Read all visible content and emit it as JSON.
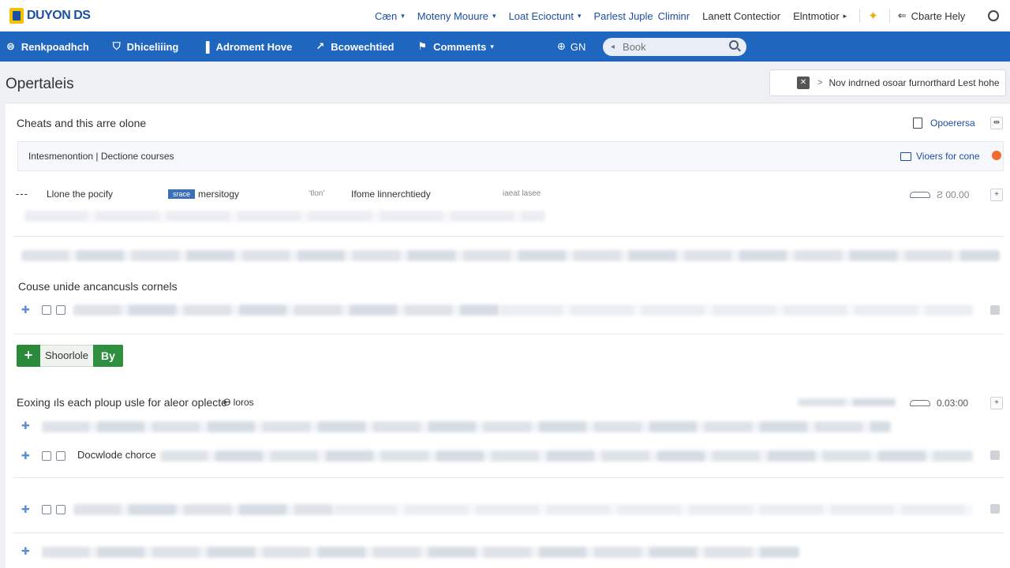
{
  "header": {
    "logo_text": "DUYON DS",
    "nav": [
      {
        "label": "Cæn",
        "caret": "▾"
      },
      {
        "label": "Moteny Mouure",
        "caret": "▾"
      },
      {
        "label": "Loat Ecioctunt",
        "caret": "▾"
      },
      {
        "label": "Parlest Juple"
      },
      {
        "label": "Climinr"
      }
    ],
    "nav_dark": [
      {
        "label": "Lanett Contectior"
      },
      {
        "label": "Elntmotior",
        "caret": "▸"
      }
    ],
    "fav_icon": "star-icon",
    "help_label": "Cbarte Hely",
    "help_back": "⇐"
  },
  "navbar": {
    "items": [
      {
        "icon": "⊜",
        "label": "Renkpoadhch"
      },
      {
        "icon": "⛉",
        "label": "Dhiceliiing"
      },
      {
        "icon": "▐",
        "label": "Adroment Hove"
      },
      {
        "icon": "↗",
        "label": "Bcowechtied"
      },
      {
        "icon": "⚑",
        "label": "Comments",
        "caret": "▾"
      }
    ],
    "lang_icon": "⊕",
    "lang_label": "GN",
    "search_placeholder": "Book",
    "search_caret": "◂"
  },
  "page": {
    "title": "Opertaleis",
    "notice_close": "✕",
    "notice_chev": ">",
    "notice_text": "Nov indrned osoar furnorthard Lest hohe"
  },
  "panel": {
    "section1_title": "Cheats and this arre olone",
    "options_label": "Opoerersa",
    "options_btn": "⇹",
    "info_text": "Intesmenontion | Dectione courses",
    "info_link": "Vioers for cone",
    "row1": {
      "dash": "---",
      "col1": "Llone the pocify",
      "tag": "srace",
      "col2": "mersitogy",
      "col3_small": "ʻtlonʻ",
      "col4": "Ifome linnerchtiedy",
      "col5_small": "iaeat lasee",
      "price": "Ƨ 00.00",
      "btn": "+"
    },
    "section2_title": "Couse unide ancancusls cornels",
    "add_plus": "+",
    "add_label": "Shoorlole",
    "add_by": "By",
    "section3_title": "Eoxing ıls each ploup usle for aleor oplecte",
    "section3_tag": "Ɵ loros",
    "section3_price": "0.03:00",
    "section3_btn": "+",
    "row_docs": "Docwlode chorce"
  }
}
